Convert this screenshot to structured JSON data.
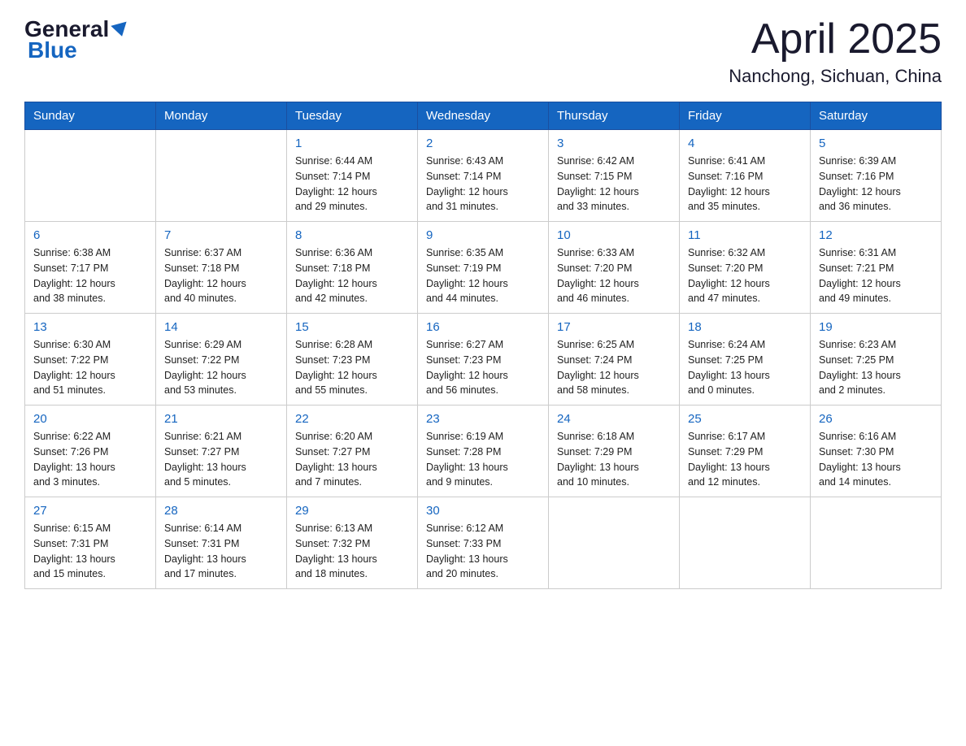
{
  "logo": {
    "general": "General",
    "blue": "Blue"
  },
  "title": "April 2025",
  "location": "Nanchong, Sichuan, China",
  "headers": [
    "Sunday",
    "Monday",
    "Tuesday",
    "Wednesday",
    "Thursday",
    "Friday",
    "Saturday"
  ],
  "weeks": [
    [
      {
        "day": "",
        "info": ""
      },
      {
        "day": "",
        "info": ""
      },
      {
        "day": "1",
        "info": "Sunrise: 6:44 AM\nSunset: 7:14 PM\nDaylight: 12 hours\nand 29 minutes."
      },
      {
        "day": "2",
        "info": "Sunrise: 6:43 AM\nSunset: 7:14 PM\nDaylight: 12 hours\nand 31 minutes."
      },
      {
        "day": "3",
        "info": "Sunrise: 6:42 AM\nSunset: 7:15 PM\nDaylight: 12 hours\nand 33 minutes."
      },
      {
        "day": "4",
        "info": "Sunrise: 6:41 AM\nSunset: 7:16 PM\nDaylight: 12 hours\nand 35 minutes."
      },
      {
        "day": "5",
        "info": "Sunrise: 6:39 AM\nSunset: 7:16 PM\nDaylight: 12 hours\nand 36 minutes."
      }
    ],
    [
      {
        "day": "6",
        "info": "Sunrise: 6:38 AM\nSunset: 7:17 PM\nDaylight: 12 hours\nand 38 minutes."
      },
      {
        "day": "7",
        "info": "Sunrise: 6:37 AM\nSunset: 7:18 PM\nDaylight: 12 hours\nand 40 minutes."
      },
      {
        "day": "8",
        "info": "Sunrise: 6:36 AM\nSunset: 7:18 PM\nDaylight: 12 hours\nand 42 minutes."
      },
      {
        "day": "9",
        "info": "Sunrise: 6:35 AM\nSunset: 7:19 PM\nDaylight: 12 hours\nand 44 minutes."
      },
      {
        "day": "10",
        "info": "Sunrise: 6:33 AM\nSunset: 7:20 PM\nDaylight: 12 hours\nand 46 minutes."
      },
      {
        "day": "11",
        "info": "Sunrise: 6:32 AM\nSunset: 7:20 PM\nDaylight: 12 hours\nand 47 minutes."
      },
      {
        "day": "12",
        "info": "Sunrise: 6:31 AM\nSunset: 7:21 PM\nDaylight: 12 hours\nand 49 minutes."
      }
    ],
    [
      {
        "day": "13",
        "info": "Sunrise: 6:30 AM\nSunset: 7:22 PM\nDaylight: 12 hours\nand 51 minutes."
      },
      {
        "day": "14",
        "info": "Sunrise: 6:29 AM\nSunset: 7:22 PM\nDaylight: 12 hours\nand 53 minutes."
      },
      {
        "day": "15",
        "info": "Sunrise: 6:28 AM\nSunset: 7:23 PM\nDaylight: 12 hours\nand 55 minutes."
      },
      {
        "day": "16",
        "info": "Sunrise: 6:27 AM\nSunset: 7:23 PM\nDaylight: 12 hours\nand 56 minutes."
      },
      {
        "day": "17",
        "info": "Sunrise: 6:25 AM\nSunset: 7:24 PM\nDaylight: 12 hours\nand 58 minutes."
      },
      {
        "day": "18",
        "info": "Sunrise: 6:24 AM\nSunset: 7:25 PM\nDaylight: 13 hours\nand 0 minutes."
      },
      {
        "day": "19",
        "info": "Sunrise: 6:23 AM\nSunset: 7:25 PM\nDaylight: 13 hours\nand 2 minutes."
      }
    ],
    [
      {
        "day": "20",
        "info": "Sunrise: 6:22 AM\nSunset: 7:26 PM\nDaylight: 13 hours\nand 3 minutes."
      },
      {
        "day": "21",
        "info": "Sunrise: 6:21 AM\nSunset: 7:27 PM\nDaylight: 13 hours\nand 5 minutes."
      },
      {
        "day": "22",
        "info": "Sunrise: 6:20 AM\nSunset: 7:27 PM\nDaylight: 13 hours\nand 7 minutes."
      },
      {
        "day": "23",
        "info": "Sunrise: 6:19 AM\nSunset: 7:28 PM\nDaylight: 13 hours\nand 9 minutes."
      },
      {
        "day": "24",
        "info": "Sunrise: 6:18 AM\nSunset: 7:29 PM\nDaylight: 13 hours\nand 10 minutes."
      },
      {
        "day": "25",
        "info": "Sunrise: 6:17 AM\nSunset: 7:29 PM\nDaylight: 13 hours\nand 12 minutes."
      },
      {
        "day": "26",
        "info": "Sunrise: 6:16 AM\nSunset: 7:30 PM\nDaylight: 13 hours\nand 14 minutes."
      }
    ],
    [
      {
        "day": "27",
        "info": "Sunrise: 6:15 AM\nSunset: 7:31 PM\nDaylight: 13 hours\nand 15 minutes."
      },
      {
        "day": "28",
        "info": "Sunrise: 6:14 AM\nSunset: 7:31 PM\nDaylight: 13 hours\nand 17 minutes."
      },
      {
        "day": "29",
        "info": "Sunrise: 6:13 AM\nSunset: 7:32 PM\nDaylight: 13 hours\nand 18 minutes."
      },
      {
        "day": "30",
        "info": "Sunrise: 6:12 AM\nSunset: 7:33 PM\nDaylight: 13 hours\nand 20 minutes."
      },
      {
        "day": "",
        "info": ""
      },
      {
        "day": "",
        "info": ""
      },
      {
        "day": "",
        "info": ""
      }
    ]
  ]
}
